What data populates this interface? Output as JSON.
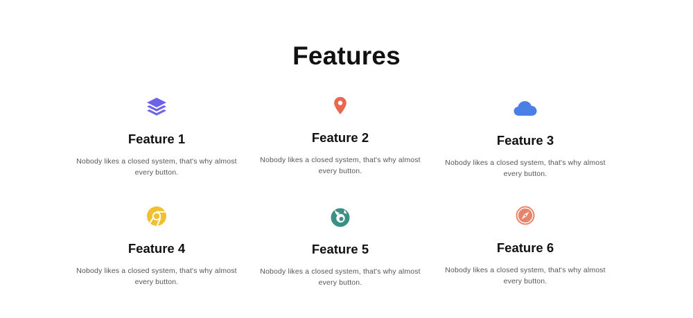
{
  "section": {
    "title": "Features"
  },
  "colors": {
    "layers": "#6c63e8",
    "pin": "#e9674d",
    "cloud": "#4a7fe6",
    "chrome": "#f0c030",
    "firefox": "#3b8f84",
    "safari": "#e8846a"
  },
  "features": [
    {
      "icon": "layers-icon",
      "title": "Feature 1",
      "description": "Nobody likes a closed system, that's why almost every button."
    },
    {
      "icon": "map-pin-icon",
      "title": "Feature 2",
      "description": "Nobody likes a closed system, that's why almost every button."
    },
    {
      "icon": "cloud-icon",
      "title": "Feature 3",
      "description": "Nobody likes a closed system, that's why almost every button."
    },
    {
      "icon": "chrome-icon",
      "title": "Feature 4",
      "description": "Nobody likes a closed system, that's why almost every button."
    },
    {
      "icon": "firefox-icon",
      "title": "Feature 5",
      "description": "Nobody likes a closed system, that's why almost every button."
    },
    {
      "icon": "safari-icon",
      "title": "Feature 6",
      "description": "Nobody likes a closed system, that's why almost every button."
    }
  ]
}
